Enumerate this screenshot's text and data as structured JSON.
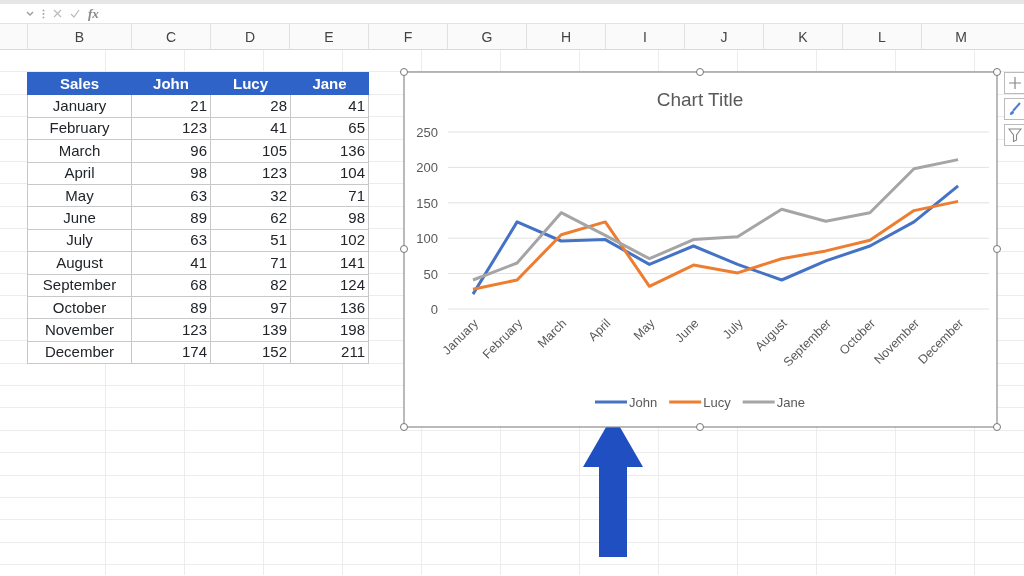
{
  "formula_bar": {
    "function_label": "fx"
  },
  "column_headers": [
    "B",
    "C",
    "D",
    "E",
    "F",
    "G",
    "H",
    "I",
    "J",
    "K",
    "L",
    "M"
  ],
  "table": {
    "columns": [
      "Sales",
      "John",
      "Lucy",
      "Jane"
    ],
    "rows": [
      [
        "January",
        "21",
        "28",
        "41"
      ],
      [
        "February",
        "123",
        "41",
        "65"
      ],
      [
        "March",
        "96",
        "105",
        "136"
      ],
      [
        "April",
        "98",
        "123",
        "104"
      ],
      [
        "May",
        "63",
        "32",
        "71"
      ],
      [
        "June",
        "89",
        "62",
        "98"
      ],
      [
        "July",
        "63",
        "51",
        "102"
      ],
      [
        "August",
        "41",
        "71",
        "141"
      ],
      [
        "September",
        "68",
        "82",
        "124"
      ],
      [
        "October",
        "89",
        "97",
        "136"
      ],
      [
        "November",
        "123",
        "139",
        "198"
      ],
      [
        "December",
        "174",
        "152",
        "211"
      ]
    ]
  },
  "chart": {
    "chart_data": {
      "type": "line",
      "title": "Chart Title",
      "categories": [
        "January",
        "February",
        "March",
        "April",
        "May",
        "June",
        "July",
        "August",
        "September",
        "October",
        "November",
        "December"
      ],
      "series": [
        {
          "name": "John",
          "color": "#4472c4",
          "values": [
            21,
            123,
            96,
            98,
            63,
            89,
            63,
            41,
            68,
            89,
            123,
            174
          ]
        },
        {
          "name": "Lucy",
          "color": "#ed7d31",
          "values": [
            28,
            41,
            105,
            123,
            32,
            62,
            51,
            71,
            82,
            97,
            139,
            152
          ]
        },
        {
          "name": "Jane",
          "color": "#a5a5a5",
          "values": [
            41,
            65,
            136,
            104,
            71,
            98,
            102,
            141,
            124,
            136,
            198,
            211
          ]
        }
      ],
      "ylim": [
        0,
        250
      ],
      "yticks": [
        0,
        50,
        100,
        150,
        200,
        250
      ],
      "grid": true,
      "legend": true
    }
  }
}
